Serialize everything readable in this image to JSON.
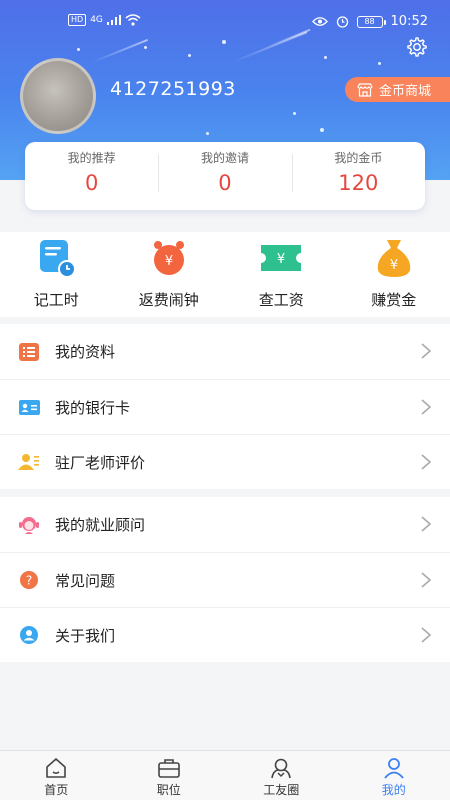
{
  "status_bar": {
    "network": "HD",
    "signal": "4G",
    "battery": "88",
    "time": "10:52"
  },
  "profile": {
    "username": "4127251993",
    "mall_button": "金币商城"
  },
  "stats": [
    {
      "label": "我的推荐",
      "value": "0"
    },
    {
      "label": "我的邀请",
      "value": "0"
    },
    {
      "label": "我的金币",
      "value": "120"
    }
  ],
  "quick_actions": [
    {
      "label": "记工时",
      "icon": "clock-record-icon",
      "color": "#3aa8f0"
    },
    {
      "label": "返费闹钟",
      "icon": "alarm-clock-icon",
      "color": "#f2653f"
    },
    {
      "label": "查工资",
      "icon": "salary-ticket-icon",
      "color": "#2ec08e"
    },
    {
      "label": "赚赏金",
      "icon": "money-bag-icon",
      "color": "#f5a623"
    }
  ],
  "menu_group_1": [
    {
      "label": "我的资料",
      "icon": "profile-list-icon"
    },
    {
      "label": "我的银行卡",
      "icon": "bank-card-icon"
    },
    {
      "label": "驻厂老师评价",
      "icon": "teacher-review-icon"
    }
  ],
  "menu_group_2": [
    {
      "label": "我的就业顾问",
      "icon": "advisor-icon"
    },
    {
      "label": "常见问题",
      "icon": "question-icon"
    },
    {
      "label": "关于我们",
      "icon": "about-us-icon"
    }
  ],
  "tabs": [
    {
      "label": "首页",
      "icon": "home-icon"
    },
    {
      "label": "职位",
      "icon": "briefcase-icon"
    },
    {
      "label": "工友圈",
      "icon": "community-icon"
    },
    {
      "label": "我的",
      "icon": "person-icon",
      "active": true
    }
  ],
  "colors": {
    "header_top": "#4f6fe8",
    "header_bottom": "#55a3f3",
    "stat_value": "#e4483f",
    "mall_button": "#f9845b",
    "active_tab": "#3b7ff2"
  }
}
